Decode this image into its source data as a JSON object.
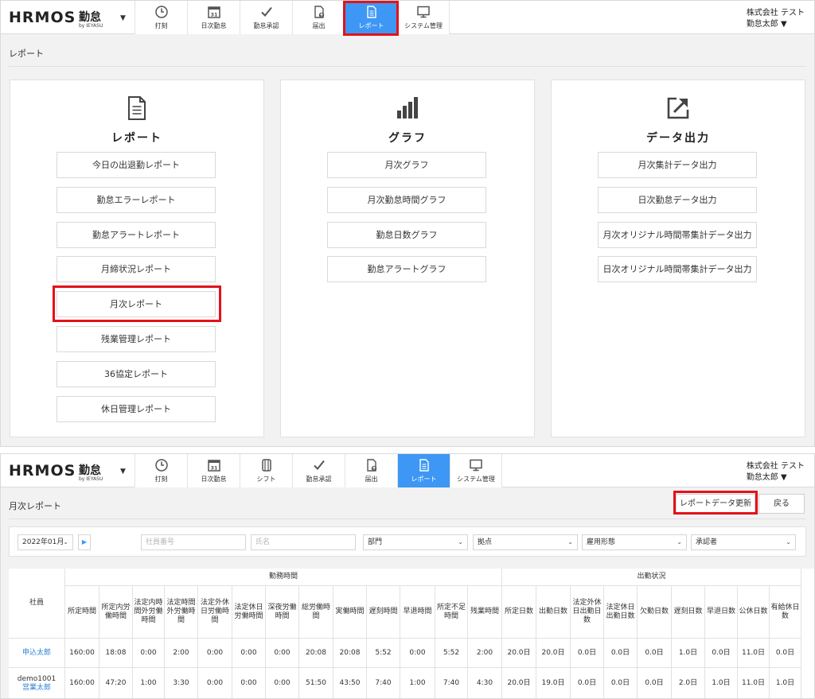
{
  "header": {
    "logo_wordmark": "HRMOS",
    "logo_product": "勤怠",
    "logo_by": "by IEYASU",
    "company": "株式会社 テスト",
    "user": "勤怠太郎 ▼"
  },
  "nav1": [
    {
      "label": "打刻",
      "icon": "clock-icon"
    },
    {
      "label": "日次勤怠",
      "icon": "calendar-icon"
    },
    {
      "label": "勤怠承認",
      "icon": "check-icon"
    },
    {
      "label": "届出",
      "icon": "document-upload-icon"
    },
    {
      "label": "レポート",
      "icon": "report-icon"
    },
    {
      "label": "システム管理",
      "icon": "monitor-icon"
    }
  ],
  "nav2": [
    {
      "label": "打刻",
      "icon": "clock-icon"
    },
    {
      "label": "日次勤怠",
      "icon": "calendar-icon"
    },
    {
      "label": "シフト",
      "icon": "shift-icon"
    },
    {
      "label": "勤怠承認",
      "icon": "check-icon"
    },
    {
      "label": "届出",
      "icon": "document-upload-icon"
    },
    {
      "label": "レポート",
      "icon": "report-icon"
    },
    {
      "label": "システム管理",
      "icon": "monitor-icon"
    }
  ],
  "calendar_day": "31",
  "breadcrumb": "レポート",
  "panels": [
    {
      "title": "レポート",
      "icon": "report-document-icon",
      "buttons": [
        "今日の出退勤レポート",
        "勤怠エラーレポート",
        "勤怠アラートレポート",
        "月締状況レポート",
        "月次レポート",
        "残業管理レポート",
        "36協定レポート",
        "休日管理レポート"
      ]
    },
    {
      "title": "グラフ",
      "icon": "bar-graph-icon",
      "buttons": [
        "月次グラフ",
        "月次勤怠時間グラフ",
        "勤怠日数グラフ",
        "勤怠アラートグラフ"
      ]
    },
    {
      "title": "データ出力",
      "icon": "export-icon",
      "buttons": [
        "月次集計データ出力",
        "日次勤怠データ出力",
        "月次オリジナル時間帯集計データ出力",
        "日次オリジナル時間帯集計データ出力"
      ]
    }
  ],
  "monthly": {
    "title": "月次レポート",
    "update_button": "レポートデータ更新",
    "back_button": "戻る",
    "filters": {
      "month": "2022年01月",
      "employee_no_placeholder": "社員番号",
      "name_placeholder": "氏名",
      "department": "部門",
      "location": "拠点",
      "employment_type": "雇用形態",
      "approver": "承認者"
    },
    "groups": {
      "work_time": "勤務時間",
      "attendance": "出勤状況"
    },
    "employee_header": "社員",
    "columns": [
      "所定時間",
      "所定内労働時間",
      "法定内時間外労働時間",
      "法定時間外労働時間",
      "法定外休日労働時間",
      "法定休日労働時間",
      "深夜労働時間",
      "総労働時間",
      "実働時間",
      "遅刻時間",
      "早退時間",
      "所定不足時間",
      "残業時間",
      "所定日数",
      "出勤日数",
      "法定外休日出勤日数",
      "法定休日出勤日数",
      "欠勤日数",
      "遅刻日数",
      "早退日数",
      "公休日数",
      "有給休日数"
    ],
    "rows": [
      {
        "code": "",
        "name": "申込太郎",
        "values": [
          "160:00",
          "18:08",
          "0:00",
          "2:00",
          "0:00",
          "0:00",
          "0:00",
          "20:08",
          "20:08",
          "5:52",
          "0:00",
          "5:52",
          "2:00",
          "20.0日",
          "20.0日",
          "0.0日",
          "0.0日",
          "0.0日",
          "1.0日",
          "0.0日",
          "11.0日",
          "0.0日"
        ]
      },
      {
        "code": "demo1001",
        "name": "営業太郎",
        "values": [
          "160:00",
          "47:20",
          "1:00",
          "3:30",
          "0:00",
          "0:00",
          "0:00",
          "51:50",
          "43:50",
          "7:40",
          "1:00",
          "7:40",
          "4:30",
          "20.0日",
          "19.0日",
          "0.0日",
          "0.0日",
          "0.0日",
          "2.0日",
          "1.0日",
          "11.0日",
          "1.0日"
        ]
      }
    ]
  }
}
